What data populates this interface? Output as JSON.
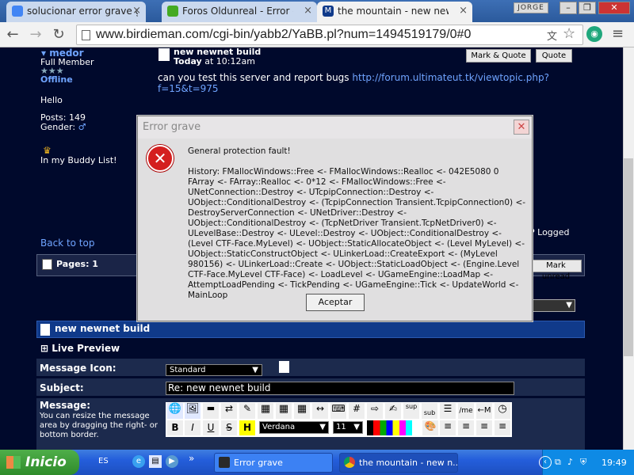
{
  "browser": {
    "tabs": [
      {
        "label": "solucionar error grave gener",
        "icon": "google-icon",
        "active": false
      },
      {
        "label": "Foros Oldunreal - Error critic",
        "icon": "unreal-icon",
        "active": false
      },
      {
        "label": "the mountain - new newnet b",
        "icon": "forum-icon",
        "active": true
      }
    ],
    "user": "JORGE",
    "url": "www.birdieman.com/cgi-bin/yabb2/YaBB.pl?num=1494519179/0#0"
  },
  "post": {
    "author": "medor",
    "rank": "Full Member",
    "stars": "★★★",
    "status": "Offline",
    "greeting": "Hello",
    "posts_label": "Posts: 149",
    "gender_label": "Gender:",
    "buddy": "In my Buddy List!",
    "title": "new newnet build",
    "date_bold": "Today",
    "time": "at 10:12am",
    "mark_quote": "Mark & Quote",
    "quote": "Quote",
    "body": "can you test this server and report bugs",
    "link": "http://forum.ultimateut.tk/viewtopic.php?f=15&t=975",
    "logged": "P Logged",
    "back_to_top": "Back to top",
    "pages": "Pages: 1",
    "mark_unread": "Mark unread"
  },
  "reply": {
    "header": "new newnet build",
    "live_preview": "Live Preview",
    "icon_label": "Message Icon:",
    "icon_value": "Standard",
    "subject_label": "Subject:",
    "subject_value": "Re: new newnet build",
    "message_label": "Message:",
    "message_hint": "You can resize the message area by dragging the right- or bottom border.",
    "font_value": "Verdana",
    "size_value": "11",
    "sup": "sup",
    "sub": "sub",
    "me": "/me",
    "b": "B",
    "i": "I",
    "u": "U",
    "s": "S",
    "h": "H"
  },
  "dialog": {
    "title": "Error grave",
    "heading": "General protection fault!",
    "history": "History: FMallocWindows::Free <- FMallocWindows::Realloc <- 042E5080 0 FArray <- FArray::Realloc <- 0*12 <- FMallocWindows::Free <- UNetConnection::Destroy <- UTcpipConnection::Destroy <- UObject::ConditionalDestroy <- (TcpipConnection Transient.TcpipConnection0) <- DestroyServerConnection <- UNetDriver::Destroy <- UObject::ConditionalDestroy <- (TcpNetDriver Transient.TcpNetDriver0) <- ULevelBase::Destroy <- ULevel::Destroy <- UObject::ConditionalDestroy <- (Level CTF-Face.MyLevel) <- UObject::StaticAllocateObject <- (Level MyLevel) <- UObject::StaticConstructObject <- ULinkerLoad::CreateExport <- (MyLevel 980156) <- ULinkerLoad::Create <- UObject::StaticLoadObject <- (Engine.Level CTF-Face.MyLevel CTF-Face) <- LoadLevel <- UGameEngine::LoadMap <- AttemptLoadPending <- TickPending <- UGameEngine::Tick <- UpdateWorld <- MainLoop",
    "ok": "Aceptar"
  },
  "taskbar": {
    "start": "Inicio",
    "lang": "ES",
    "items": [
      {
        "label": "Error grave",
        "icon": "unreal-icon"
      },
      {
        "label": "the mountain - new n...",
        "icon": "chrome-icon"
      }
    ],
    "clock": "19:49"
  },
  "colors": {
    "page_bg": "#00092c",
    "link": "#6fa4ff",
    "error_red": "#d41f1f"
  }
}
